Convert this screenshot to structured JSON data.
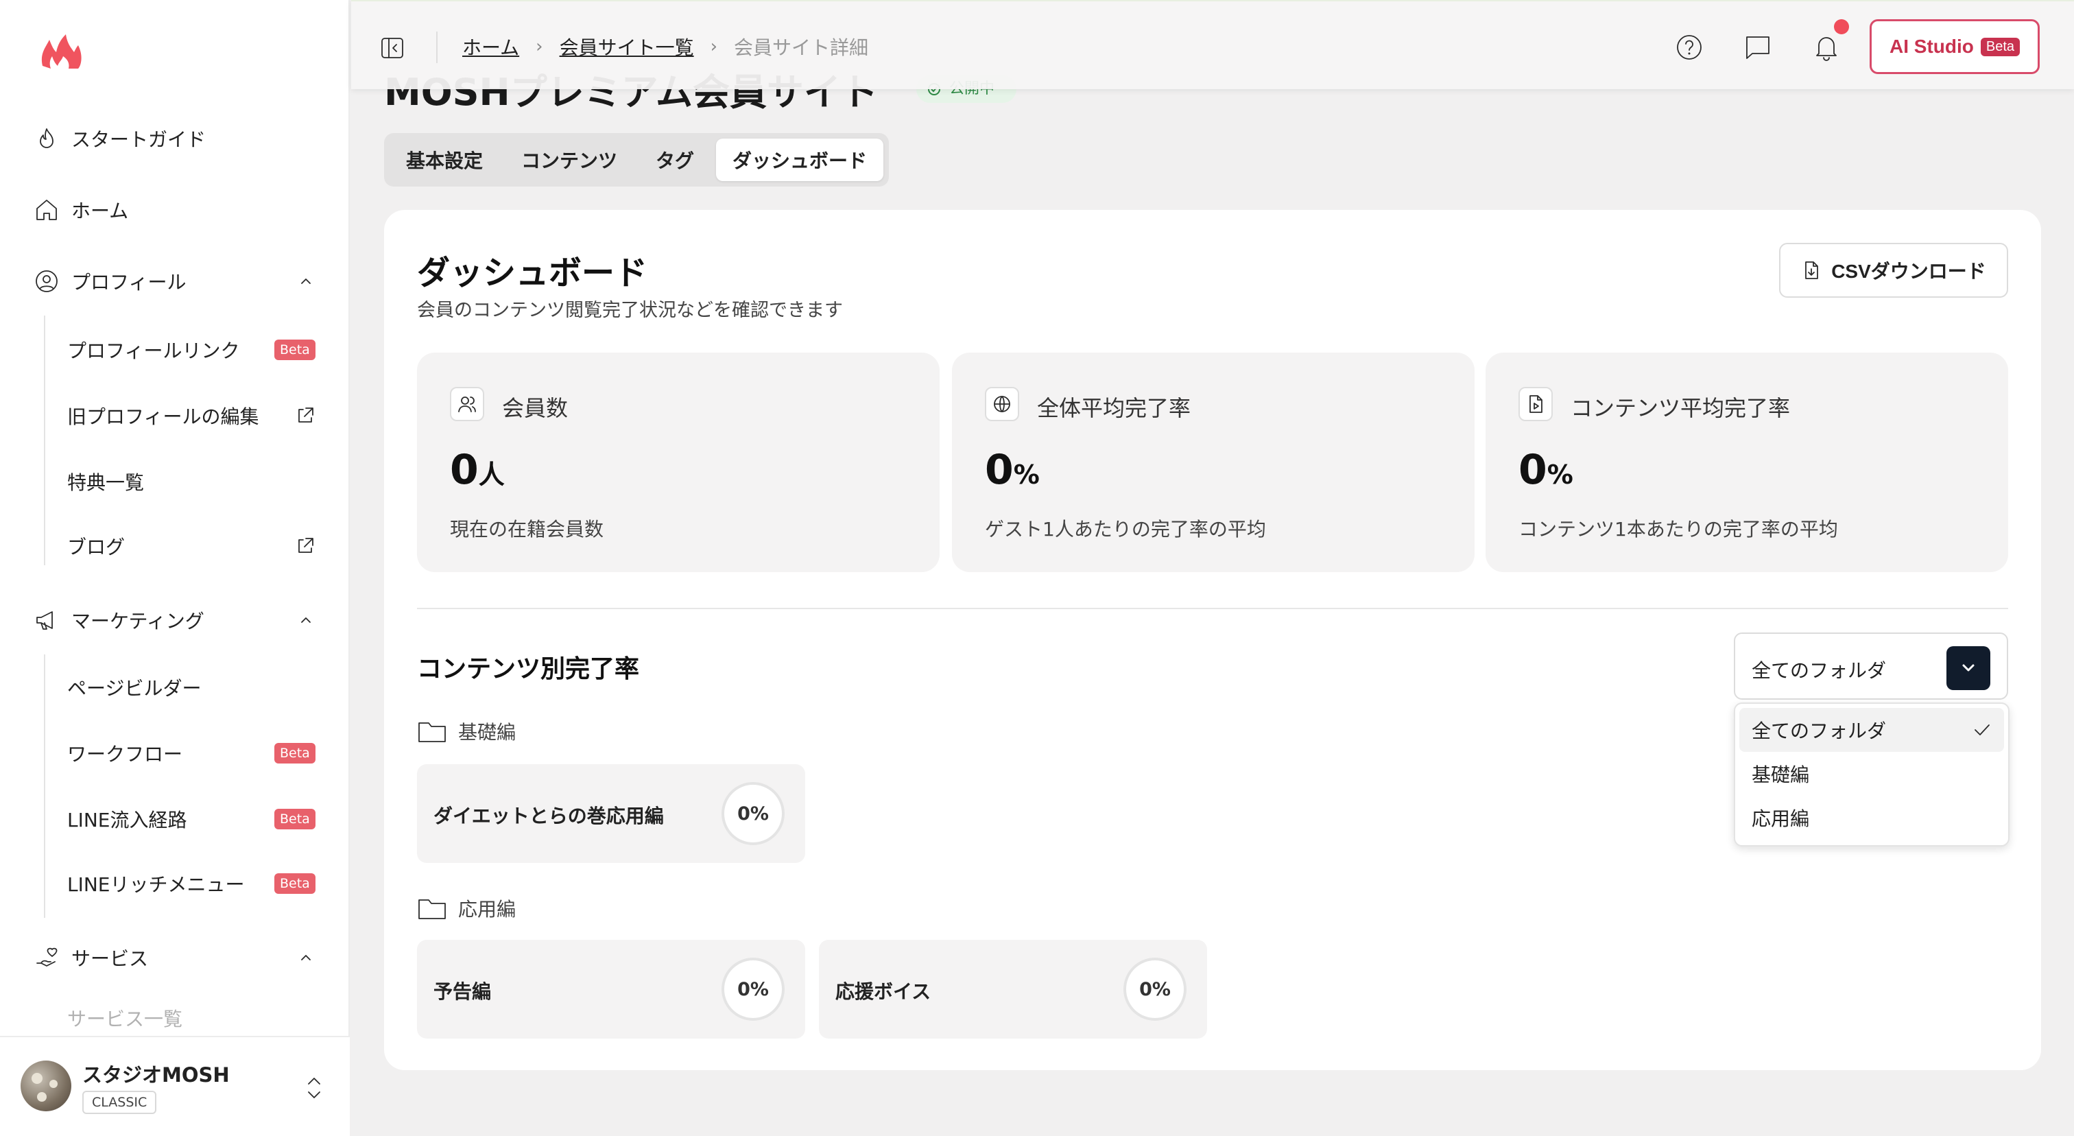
{
  "sidebar": {
    "nav": [
      {
        "label": "スタートガイド",
        "icon": "flame-outline-icon"
      },
      {
        "label": "ホーム",
        "icon": "home-icon"
      },
      {
        "label": "プロフィール",
        "icon": "user-circle-icon"
      }
    ],
    "profile_sub": [
      {
        "label": "プロフィールリンク",
        "badge": "Beta"
      },
      {
        "label": "旧プロフィールの編集",
        "icon": "external-link-icon"
      },
      {
        "label": "特典一覧"
      },
      {
        "label": "ブログ",
        "icon": "external-link-icon"
      }
    ],
    "marketing": {
      "label": "マーケティング",
      "icon": "megaphone-icon"
    },
    "marketing_sub": [
      {
        "label": "ページビルダー"
      },
      {
        "label": "ワークフロー",
        "badge": "Beta"
      },
      {
        "label": "LINE流入経路",
        "badge": "Beta"
      },
      {
        "label": "LINEリッチメニュー",
        "badge": "Beta"
      }
    ],
    "services": {
      "label": "サービス",
      "icon": "hand-heart-icon"
    },
    "services_sub": [
      {
        "label": "サービス一覧"
      }
    ],
    "footer": {
      "name": "スタジオMOSH",
      "plan": "CLASSIC"
    }
  },
  "header": {
    "breadcrumb": [
      "ホーム",
      "会員サイト一覧",
      "会員サイト詳細"
    ],
    "ai_studio": {
      "label": "AI Studio",
      "badge": "Beta"
    }
  },
  "page": {
    "title": "MOSHプレミアム会員サイト",
    "status": "公開中",
    "tabs": [
      "基本設定",
      "コンテンツ",
      "タグ",
      "ダッシュボード"
    ],
    "active_tab": "ダッシュボード"
  },
  "dashboard": {
    "title": "ダッシュボード",
    "subtitle": "会員のコンテンツ閲覧完了状況などを確認できます",
    "csv_button": "CSVダウンロード",
    "stats": [
      {
        "label": "会員数",
        "value": "0",
        "unit": "人",
        "desc": "現在の在籍会員数",
        "icon": "users-icon"
      },
      {
        "label": "全体平均完了率",
        "value": "0",
        "unit": "%",
        "desc": "ゲスト1人あたりの完了率の平均",
        "icon": "globe-icon"
      },
      {
        "label": "コンテンツ平均完了率",
        "value": "0",
        "unit": "%",
        "desc": "コンテンツ1本あたりの完了率の平均",
        "icon": "file-video-icon"
      }
    ],
    "section_title": "コンテンツ別完了率",
    "folder_select": {
      "value": "全てのフォルダ",
      "options": [
        "全てのフォルダ",
        "基礎編",
        "応用編"
      ]
    },
    "folders": [
      {
        "name": "基礎編",
        "items": [
          {
            "title": "ダイエットとらの巻応用編",
            "rate": "0%"
          }
        ]
      },
      {
        "name": "応用編",
        "items": [
          {
            "title": "予告編",
            "rate": "0%"
          },
          {
            "title": "応援ボイス",
            "rate": "0%"
          }
        ]
      }
    ]
  },
  "colors": {
    "accent": "#d84b6a",
    "beta_badge": "#e8616b",
    "brand_flame": "#f0545f",
    "select_button": "#111c2c"
  }
}
